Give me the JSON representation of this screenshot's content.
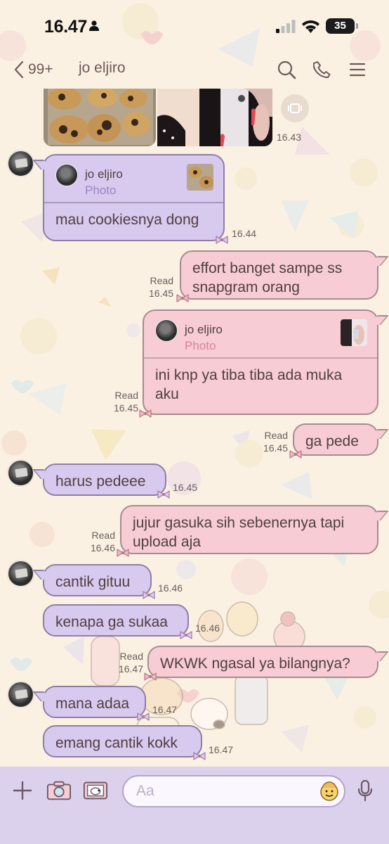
{
  "status_bar": {
    "time": "16.47",
    "battery": "35"
  },
  "header": {
    "unread_count": "99+",
    "contact_name": "jo eljiro"
  },
  "messages": [
    {
      "id": "m0",
      "time": "16.43"
    },
    {
      "id": "m1",
      "text": "mau cookiesnya dong",
      "time": "16.44",
      "reply": {
        "name": "jo eljiro",
        "type": "Photo"
      }
    },
    {
      "id": "m2",
      "text": "effort banget sampe ss\nsnapgram orang",
      "read": "Read",
      "time": "16.45"
    },
    {
      "id": "m3",
      "text": "ini knp ya tiba tiba ada muka\naku",
      "read": "Read",
      "time": "16.45",
      "reply": {
        "name": "jo eljiro",
        "type": "Photo"
      }
    },
    {
      "id": "m4",
      "text": "ga pede",
      "read": "Read",
      "time": "16.45"
    },
    {
      "id": "m5",
      "text": "harus pedeee",
      "time": "16.45"
    },
    {
      "id": "m6",
      "text": "jujur gasuka sih sebenernya tapi\nupload aja",
      "read": "Read",
      "time": "16.46"
    },
    {
      "id": "m7",
      "text": "cantik gituu",
      "time": "16.46"
    },
    {
      "id": "m8",
      "text": "kenapa ga sukaa",
      "time": "16.46"
    },
    {
      "id": "m9",
      "text": "WKWK ngasal ya bilangnya?",
      "read": "Read",
      "time": "16.47"
    },
    {
      "id": "m10",
      "text": "mana adaa",
      "time": "16.47"
    },
    {
      "id": "m11",
      "text": "emang cantik kokk",
      "time": "16.47"
    }
  ],
  "input": {
    "placeholder": "Aa"
  },
  "colors": {
    "incoming_bubble": "#d8c9ef",
    "outgoing_bubble": "#f7ccd4",
    "background": "#fbf1e2",
    "input_bar": "#dcd1ec"
  }
}
